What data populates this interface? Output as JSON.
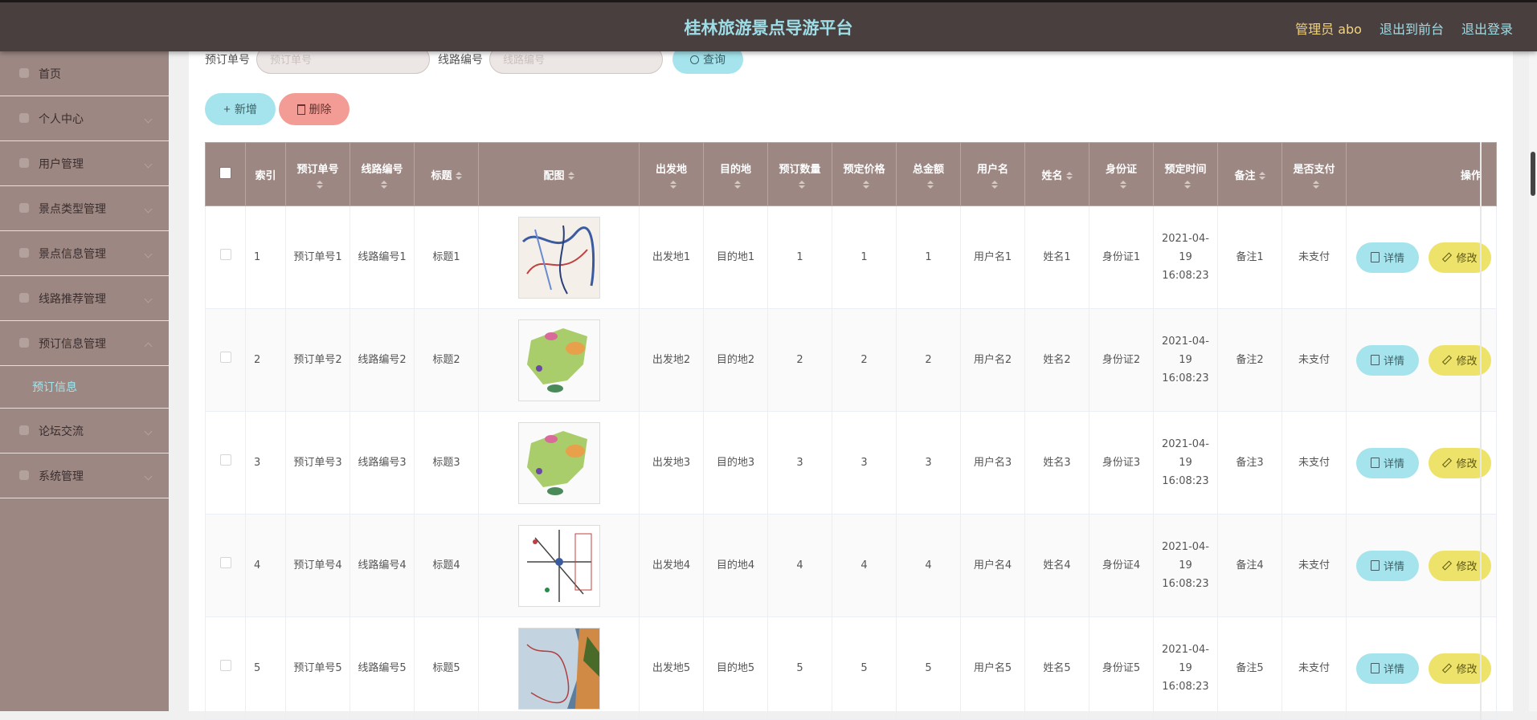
{
  "header": {
    "title": "桂林旅游景点导游平台",
    "admin_label": "管理员 abo",
    "front_link": "退出到前台",
    "logout_link": "退出登录"
  },
  "sidebar": {
    "items": [
      {
        "label": "首页"
      },
      {
        "label": "个人中心"
      },
      {
        "label": "用户管理"
      },
      {
        "label": "景点类型管理"
      },
      {
        "label": "景点信息管理"
      },
      {
        "label": "线路推荐管理"
      },
      {
        "label": "预订信息管理"
      },
      {
        "label": "论坛交流"
      },
      {
        "label": "系统管理"
      }
    ],
    "active_sub": "预订信息"
  },
  "search": {
    "order_label": "预订单号",
    "order_placeholder": "预订单号",
    "route_label": "线路编号",
    "route_placeholder": "线路编号",
    "query_button": "查询"
  },
  "actions": {
    "add_button": "新增",
    "delete_button": "删除"
  },
  "table": {
    "headers": [
      "索引",
      "预订单号",
      "线路编号",
      "标题",
      "配图",
      "出发地",
      "目的地",
      "预订数量",
      "预定价格",
      "总金额",
      "用户名",
      "姓名",
      "身份证",
      "预定时间",
      "备注",
      "是否支付",
      "操作"
    ],
    "detail_button": "详情",
    "edit_button": "修改",
    "rows": [
      {
        "index": "1",
        "order_no": "预订单号1",
        "route_no": "线路编号1",
        "title": "标题1",
        "image": "map-thumbnail-1",
        "from": "出发地1",
        "to": "目的地1",
        "qty": "1",
        "price": "1",
        "total": "1",
        "username": "用户名1",
        "name": "姓名1",
        "id_card": "身份证1",
        "time": "2021-04-19 16:08:23",
        "remark": "备注1",
        "paid": "未支付"
      },
      {
        "index": "2",
        "order_no": "预订单号2",
        "route_no": "线路编号2",
        "title": "标题2",
        "image": "map-thumbnail-2",
        "from": "出发地2",
        "to": "目的地2",
        "qty": "2",
        "price": "2",
        "total": "2",
        "username": "用户名2",
        "name": "姓名2",
        "id_card": "身份证2",
        "time": "2021-04-19 16:08:23",
        "remark": "备注2",
        "paid": "未支付"
      },
      {
        "index": "3",
        "order_no": "预订单号3",
        "route_no": "线路编号3",
        "title": "标题3",
        "image": "map-thumbnail-3",
        "from": "出发地3",
        "to": "目的地3",
        "qty": "3",
        "price": "3",
        "total": "3",
        "username": "用户名3",
        "name": "姓名3",
        "id_card": "身份证3",
        "time": "2021-04-19 16:08:23",
        "remark": "备注3",
        "paid": "未支付"
      },
      {
        "index": "4",
        "order_no": "预订单号4",
        "route_no": "线路编号4",
        "title": "标题4",
        "image": "map-thumbnail-4",
        "from": "出发地4",
        "to": "目的地4",
        "qty": "4",
        "price": "4",
        "total": "4",
        "username": "用户名4",
        "name": "姓名4",
        "id_card": "身份证4",
        "time": "2021-04-19 16:08:23",
        "remark": "备注4",
        "paid": "未支付"
      },
      {
        "index": "5",
        "order_no": "预订单号5",
        "route_no": "线路编号5",
        "title": "标题5",
        "image": "map-thumbnail-5",
        "from": "出发地5",
        "to": "目的地5",
        "qty": "5",
        "price": "5",
        "total": "5",
        "username": "用户名5",
        "name": "姓名5",
        "id_card": "身份证5",
        "time": "2021-04-19 16:08:23",
        "remark": "备注5",
        "paid": "未支付"
      }
    ]
  }
}
